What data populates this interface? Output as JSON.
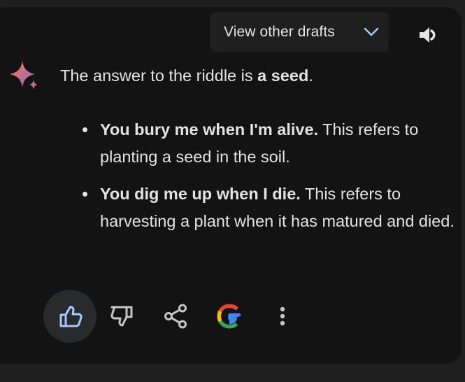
{
  "response": {
    "drafts_label": "View other drafts",
    "intro_prefix": "The answer to the riddle is ",
    "intro_answer": "a seed",
    "intro_suffix": ".",
    "bullets": [
      {
        "bold": "You bury me when I'm alive.",
        "text": " This refers to planting a seed in the soil."
      },
      {
        "bold": "You dig me up when I die.",
        "text": " This refers to harvesting a plant when it has matured and died."
      }
    ]
  },
  "actions": [
    {
      "icon": "thumbs-up-icon",
      "selected": true
    },
    {
      "icon": "thumbs-down-icon",
      "selected": false
    },
    {
      "icon": "share-icon",
      "selected": false
    },
    {
      "icon": "google-g-icon",
      "selected": false
    },
    {
      "icon": "more-vertical-icon",
      "selected": false
    }
  ],
  "colors": {
    "background": "#1f1f20",
    "card": "#131314",
    "text": "#e3e3e3",
    "accent": "#a8c7fa",
    "button": "#1f1f1f",
    "selected_action": "#282a2c"
  }
}
